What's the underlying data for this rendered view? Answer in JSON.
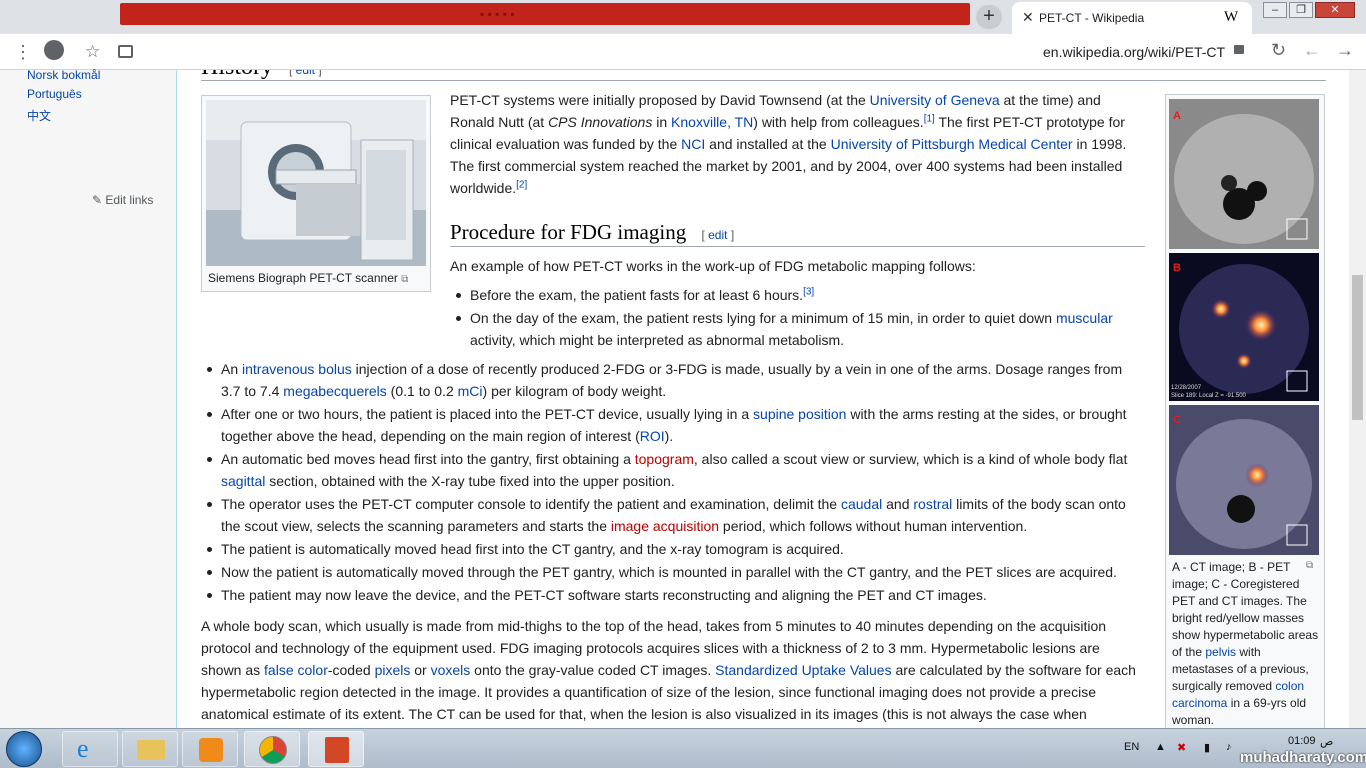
{
  "browser": {
    "tab_title": "PET-CT - Wikipedia",
    "tab_favicon": "W",
    "url": "en.wikipedia.org/wiki/PET-CT",
    "window_buttons": [
      "–",
      "❐",
      "✕"
    ]
  },
  "sidebar": {
    "languages": [
      "Norsk bokmål",
      "Português",
      "中文"
    ],
    "edit_links": "Edit links"
  },
  "history": {
    "heading": "History",
    "edit": "edit",
    "para": [
      "PET-CT systems were initially proposed by David Townsend (at the ",
      "University of Geneva",
      " at the time) and Ronald Nutt (at ",
      "CPS Innovations",
      " in ",
      "Knoxville, TN",
      ") with help from colleagues.",
      "[1]",
      " The first PET-CT prototype for clinical evaluation was funded by the ",
      "NCI",
      " and installed at the ",
      "University of Pittsburgh Medical Center",
      " in 1998. The first commercial system reached the market by 2001, and by 2004, over 400 systems had been installed worldwide.",
      "[2]"
    ],
    "thumb_caption": "Siemens Biograph PET-CT scanner"
  },
  "procedure": {
    "heading": "Procedure for FDG imaging",
    "edit": "edit",
    "intro": "An example of how PET-CT works in the work-up of FDG metabolic mapping follows:",
    "b1": [
      "Before the exam, the patient fasts for at least 6 hours.",
      "[3]"
    ],
    "b2": [
      "On the day of the exam, the patient rests lying for a minimum of 15 min, in order to quiet down ",
      "muscular",
      " activity, which might be interpreted as abnormal metabolism."
    ],
    "b3": [
      "An ",
      "intravenous bolus",
      " injection of a dose of recently produced 2-FDG or 3-FDG is made, usually by a vein in one of the arms. Dosage ranges from 3.7 to 7.4 ",
      "megabecquerels",
      " (0.1 to 0.2 ",
      "mCi",
      ") per kilogram of body weight."
    ],
    "b4": [
      "After one or two hours, the patient is placed into the PET-CT device, usually lying in a ",
      "supine position",
      " with the arms resting at the sides, or brought together above the head, depending on the main region of interest (",
      "ROI",
      ")."
    ],
    "b5": [
      "An automatic bed moves head first into the gantry, first obtaining a ",
      "topogram",
      ", also called a scout view or surview, which is a kind of whole body flat ",
      "sagittal",
      " section, obtained with the X-ray tube fixed into the upper position."
    ],
    "b6": [
      "The operator uses the PET-CT computer console to identify the patient and examination, delimit the ",
      "caudal",
      " and ",
      "rostral",
      " limits of the body scan onto the scout view, selects the scanning parameters and starts the ",
      "image acquisition",
      " period, which follows without human intervention."
    ],
    "b7": "The patient is automatically moved head first into the CT gantry, and the x-ray tomogram is acquired.",
    "b8": "Now the patient is automatically moved through the PET gantry, which is mounted in parallel with the CT gantry, and the PET slices are acquired.",
    "b9": "The patient may now leave the device, and the PET-CT software starts reconstructing and aligning the PET and CT images.",
    "para": [
      "A whole body scan, which usually is made from mid-thighs to the top of the head, takes from 5 minutes to 40 minutes depending on the acquisition protocol and technology of the equipment used. FDG imaging protocols acquires slices with a thickness of 2 to 3 mm. Hypermetabolic lesions are shown as ",
      "false color",
      "-coded ",
      "pixels",
      " or ",
      "voxels",
      " onto the gray-value coded CT images. ",
      "Standardized Uptake Values",
      " are calculated by the software for each hypermetabolic region detected in the image. It provides a quantification of size of the lesion, since functional imaging does not provide a precise anatomical estimate of its extent. The CT can be used for that, when the lesion is also visualized in its images (this is not always the case when"
    ]
  },
  "right_thumb": {
    "labels": [
      "A",
      "B",
      "C"
    ],
    "date": "12/28/2007",
    "slice_b": "Slice 189: Local Z = -91.500",
    "caption": [
      "A - CT image; B - PET image; C - Coregistered PET and CT images. The bright red/yellow masses show hypermetabolic areas of the ",
      "pelvis",
      " with metastases of a previous, surgically removed ",
      "colon carcinoma",
      " in a 69-yrs old woman."
    ]
  },
  "taskbar": {
    "lang": "EN",
    "clock": "01:09",
    "ampm": "ص",
    "watermark": "muhadharaty.com"
  },
  "colors": {
    "link": "#0645ad",
    "redlink": "#ba0000",
    "sidebar_bg": "#f6f6f6"
  }
}
